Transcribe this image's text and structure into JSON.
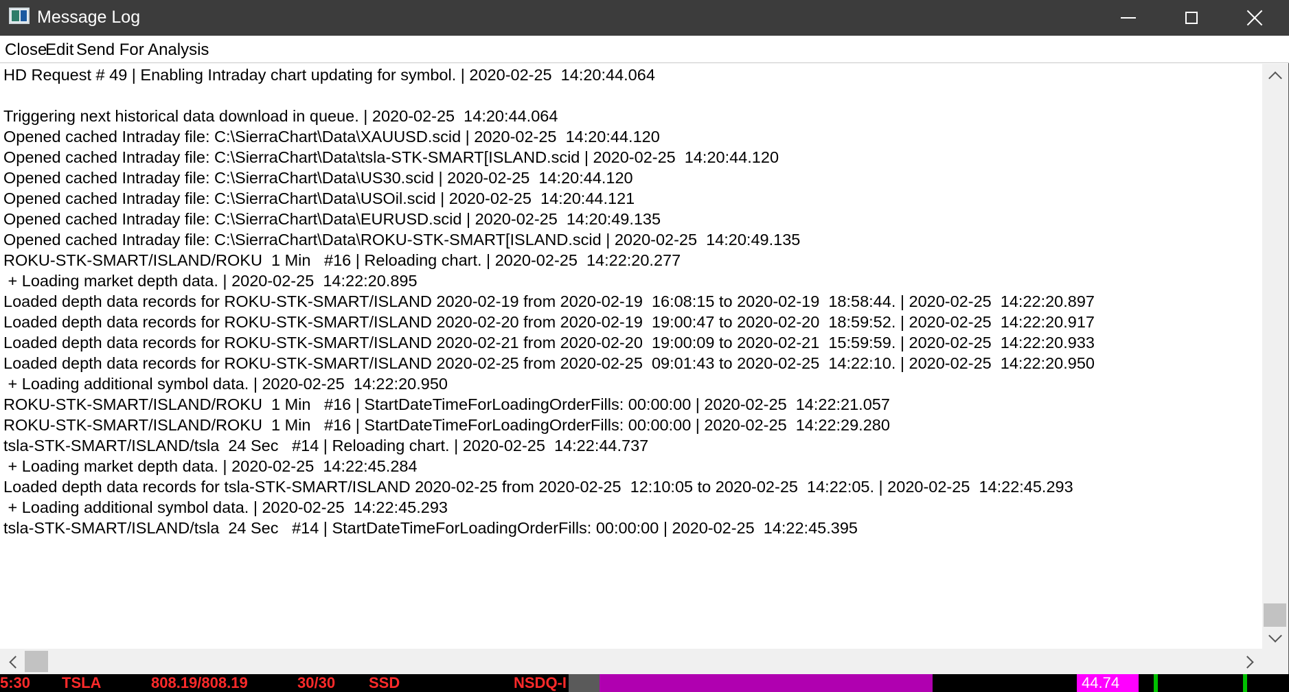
{
  "window": {
    "title": "Message Log"
  },
  "icons": {
    "app": "app-icon",
    "minimize": "minimize-icon",
    "maximize": "maximize-icon",
    "close": "close-icon"
  },
  "menu": {
    "close_label": "Close",
    "edit_label": "Edit",
    "send_label": "Send For Analysis"
  },
  "log": {
    "lines": [
      "HD Request # 49 | Enabling Intraday chart updating for symbol. | 2020-02-25  14:20:44.064",
      "",
      "Triggering next historical data download in queue. | 2020-02-25  14:20:44.064",
      "Opened cached Intraday file: C:\\SierraChart\\Data\\XAUUSD.scid | 2020-02-25  14:20:44.120",
      "Opened cached Intraday file: C:\\SierraChart\\Data\\tsla-STK-SMART[ISLAND.scid | 2020-02-25  14:20:44.120",
      "Opened cached Intraday file: C:\\SierraChart\\Data\\US30.scid | 2020-02-25  14:20:44.120",
      "Opened cached Intraday file: C:\\SierraChart\\Data\\USOil.scid | 2020-02-25  14:20:44.121",
      "Opened cached Intraday file: C:\\SierraChart\\Data\\EURUSD.scid | 2020-02-25  14:20:49.135",
      "Opened cached Intraday file: C:\\SierraChart\\Data\\ROKU-STK-SMART[ISLAND.scid | 2020-02-25  14:20:49.135",
      "ROKU-STK-SMART/ISLAND/ROKU  1 Min   #16 | Reloading chart. | 2020-02-25  14:22:20.277",
      " + Loading market depth data. | 2020-02-25  14:22:20.895",
      "Loaded depth data records for ROKU-STK-SMART/ISLAND 2020-02-19 from 2020-02-19  16:08:15 to 2020-02-19  18:58:44. | 2020-02-25  14:22:20.897",
      "Loaded depth data records for ROKU-STK-SMART/ISLAND 2020-02-20 from 2020-02-19  19:00:47 to 2020-02-20  18:59:52. | 2020-02-25  14:22:20.917",
      "Loaded depth data records for ROKU-STK-SMART/ISLAND 2020-02-21 from 2020-02-20  19:00:09 to 2020-02-21  15:59:59. | 2020-02-25  14:22:20.933",
      "Loaded depth data records for ROKU-STK-SMART/ISLAND 2020-02-25 from 2020-02-25  09:01:43 to 2020-02-25  14:22:10. | 2020-02-25  14:22:20.950",
      " + Loading additional symbol data. | 2020-02-25  14:22:20.950",
      "ROKU-STK-SMART/ISLAND/ROKU  1 Min   #16 | StartDateTimeForLoadingOrderFills: 00:00:00 | 2020-02-25  14:22:21.057",
      "ROKU-STK-SMART/ISLAND/ROKU  1 Min   #16 | StartDateTimeForLoadingOrderFills: 00:00:00 | 2020-02-25  14:22:29.280",
      "tsla-STK-SMART/ISLAND/tsla  24 Sec   #14 | Reloading chart. | 2020-02-25  14:22:44.737",
      " + Loading market depth data. | 2020-02-25  14:22:45.284",
      "Loaded depth data records for tsla-STK-SMART/ISLAND 2020-02-25 from 2020-02-25  12:10:05 to 2020-02-25  14:22:05. | 2020-02-25  14:22:45.293",
      " + Loading additional symbol data. | 2020-02-25  14:22:45.293",
      "tsla-STK-SMART/ISLAND/tsla  24 Sec   #14 | StartDateTimeForLoadingOrderFills: 00:00:00 | 2020-02-25  14:22:45.395"
    ]
  },
  "background_strip": {
    "items": [
      "5:30",
      "TSLA",
      "808.19/808.19",
      "30/30",
      "SSD",
      "NSDQ-I",
      "44.74"
    ],
    "colors": {
      "text_red": "#ff2a2a",
      "magenta": "#b000b0",
      "bright_magenta": "#ff00ff",
      "gray": "#5a5a5a"
    }
  },
  "colors": {
    "titlebar_bg": "#3c3c3c",
    "window_bg": "#ffffff",
    "scrollbar_bg": "#f0f0f0",
    "scroll_thumb": "#c2c2c2"
  }
}
